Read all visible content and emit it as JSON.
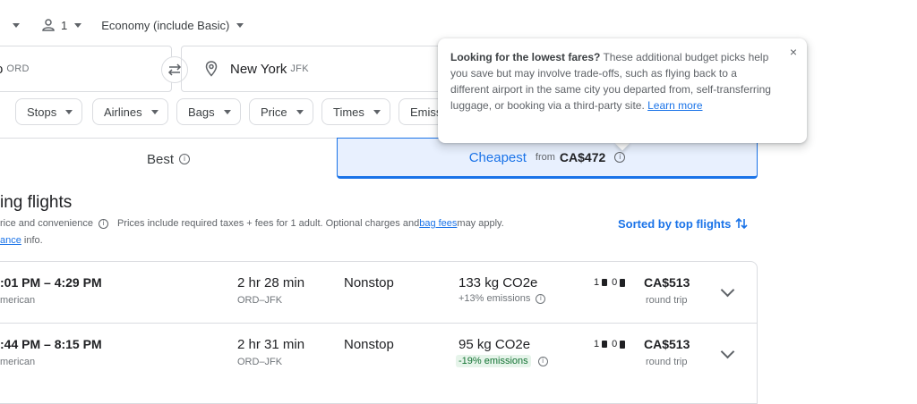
{
  "search": {
    "trip_type_caret": "",
    "passengers": "1",
    "cabin": "Economy (include Basic)",
    "origin_partial": "o",
    "origin_code": "ORD",
    "destination_city": "New York",
    "destination_code": "JFK"
  },
  "filters": [
    "Stops",
    "Airlines",
    "Bags",
    "Price",
    "Times",
    "Emiss"
  ],
  "tabs": {
    "best": "Best",
    "cheapest": "Cheapest",
    "cheapest_from": "from",
    "cheapest_price": "CA$472"
  },
  "tooltip": {
    "bold": "Looking for the lowest fares?",
    "text": " These additional budget picks help you save but may involve trade-offs, such as flying back to a different airport in the same city you departed from, self-transferring luggage, or booking via a third-party site. ",
    "link": "Learn more",
    "close": "×"
  },
  "section": {
    "title": "ing flights",
    "line1_a": "rice and convenience",
    "line1_b": "Prices include required taxes + fees for 1 adult. Optional charges and ",
    "bag_fees_link": "bag fees",
    "line1_c": " may apply.",
    "line2_link": "ance",
    "line2_rest": " info.",
    "sorted": "Sorted by top flights"
  },
  "flights": [
    {
      "times": ":01 PM – 4:29 PM",
      "airline": "merican",
      "duration": "2 hr 28 min",
      "route": "ORD–JFK",
      "stops": "Nonstop",
      "co2": "133 kg CO2e",
      "emissions": "+13% emissions",
      "emissions_good": false,
      "carry_on": "1",
      "checked": "0",
      "price": "CA$513",
      "price_note": "round trip"
    },
    {
      "times": ":44 PM – 8:15 PM",
      "airline": "merican",
      "duration": "2 hr 31 min",
      "route": "ORD–JFK",
      "stops": "Nonstop",
      "co2": "95 kg CO2e",
      "emissions": "-19% emissions",
      "emissions_good": true,
      "carry_on": "1",
      "checked": "0",
      "price": "CA$513",
      "price_note": "round trip"
    }
  ],
  "colors": {
    "accent": "#1a73e8",
    "tab_bg": "#e8f0fe",
    "good_bg": "#e6f4ea",
    "good_text": "#137333"
  }
}
